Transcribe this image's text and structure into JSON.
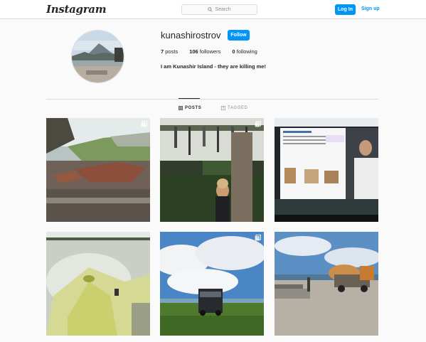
{
  "header": {
    "logo": "Instagram",
    "search_placeholder": "Search",
    "login_label": "Log In",
    "signup_label": "Sign up"
  },
  "profile": {
    "username": "kunashirostrov",
    "follow_label": "Follow",
    "posts_count": "7",
    "posts_label": "posts",
    "followers_count": "106",
    "followers_label": "followers",
    "following_count": "0",
    "following_label": "following",
    "bio": "I am Kunashir Island - they are killing me!"
  },
  "tabs": {
    "posts": "POSTS",
    "tagged": "TAGGED"
  },
  "posts": [
    {
      "icon": "carousel-icon"
    },
    {
      "icon": "carousel-icon"
    },
    {
      "icon": "none"
    },
    {
      "icon": "none"
    },
    {
      "icon": "carousel-icon"
    },
    {
      "icon": "none"
    }
  ],
  "colors": {
    "accent": "#0095f6",
    "background": "#fafafa",
    "border": "#dbdbdb",
    "text": "#262626",
    "muted": "#8e8e8e"
  }
}
